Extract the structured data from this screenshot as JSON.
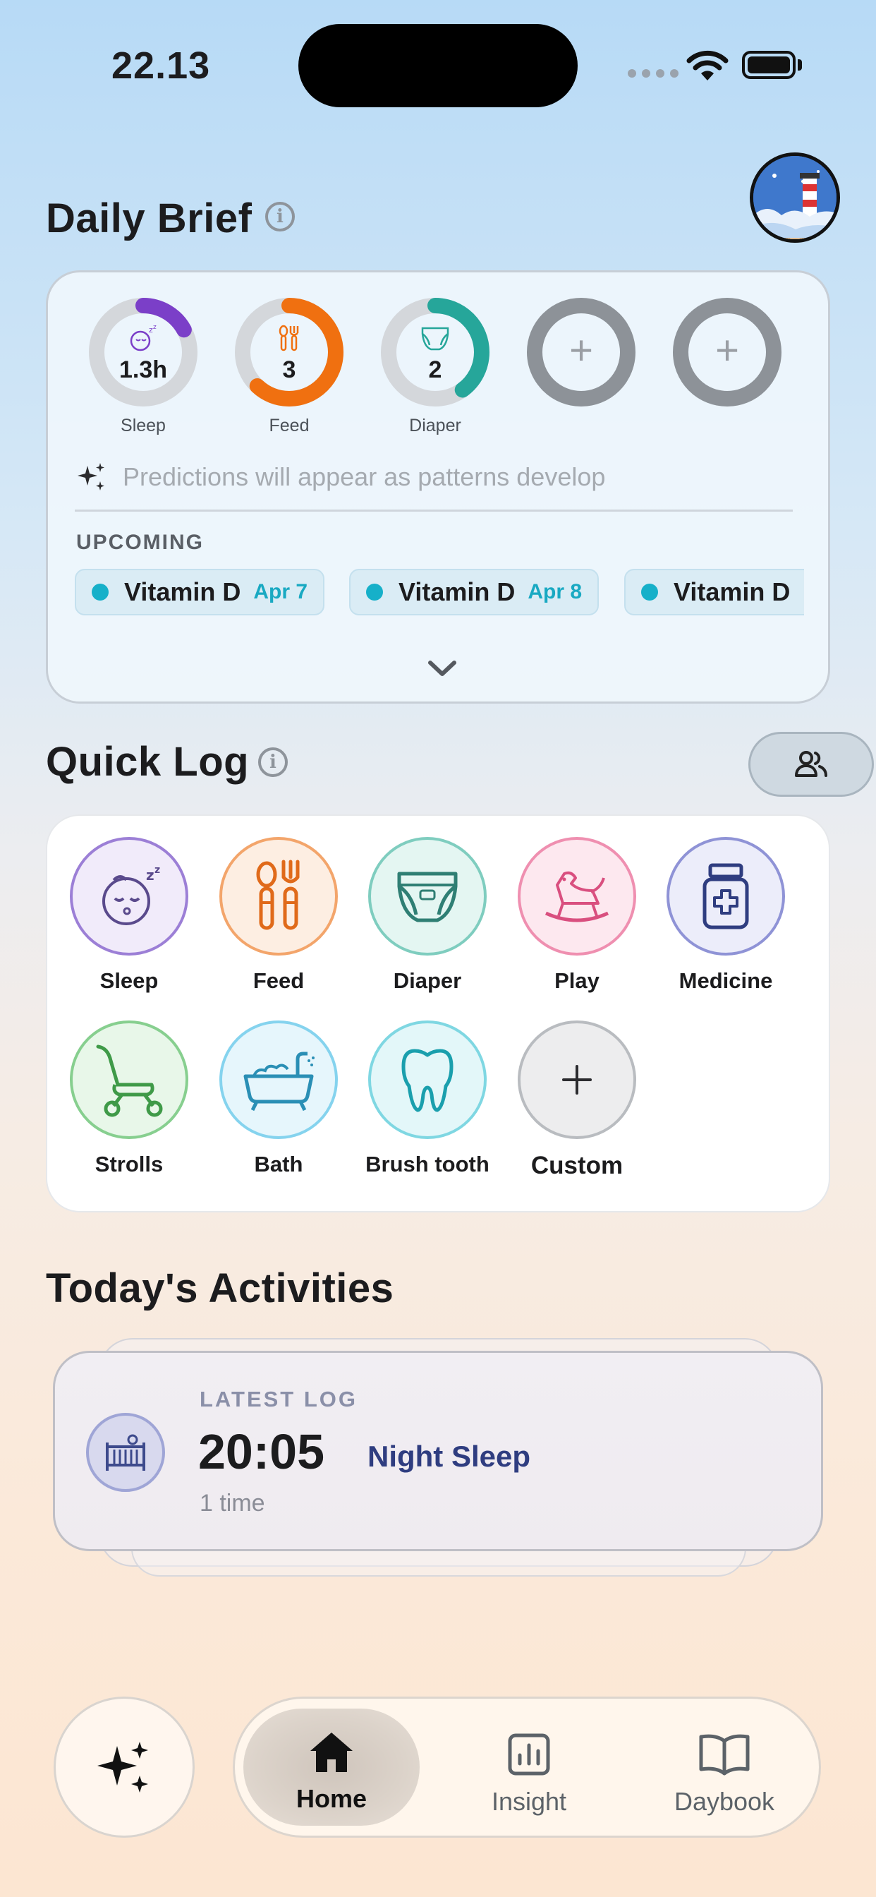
{
  "status_bar": {
    "time": "22.13"
  },
  "daily_brief": {
    "title": "Daily Brief",
    "rings": [
      {
        "label": "Sleep",
        "value": "1.3h",
        "color": "#7b3fc8",
        "progress": 0.17
      },
      {
        "label": "Feed",
        "value": "3",
        "color": "#f07010",
        "progress": 0.62
      },
      {
        "label": "Diaper",
        "value": "2",
        "color": "#26a69a",
        "progress": 0.4
      },
      {
        "label": "",
        "value": "+",
        "color": "#8d9298",
        "progress": 1
      },
      {
        "label": "",
        "value": "+",
        "color": "#8d9298",
        "progress": 1
      }
    ],
    "prediction_text": "Predictions will appear as patterns develop",
    "upcoming_heading": "UPCOMING",
    "upcoming": [
      {
        "name": "Vitamin D",
        "date": "Apr 7"
      },
      {
        "name": "Vitamin D",
        "date": "Apr 8"
      },
      {
        "name": "Vitamin D",
        "date": ""
      }
    ]
  },
  "quick_log": {
    "title": "Quick Log",
    "items": [
      {
        "label": "Sleep",
        "icon": "sleeping-baby-icon",
        "border": "#9c7fd6",
        "bg": "#f1ebfa"
      },
      {
        "label": "Feed",
        "icon": "spoon-fork-icon",
        "border": "#f3a56b",
        "bg": "#fdeee2"
      },
      {
        "label": "Diaper",
        "icon": "diaper-icon",
        "border": "#7fcdbf",
        "bg": "#e4f6f2"
      },
      {
        "label": "Play",
        "icon": "rocking-horse-icon",
        "border": "#ef8fb0",
        "bg": "#fde8ef"
      },
      {
        "label": "Medicine",
        "icon": "medicine-bottle-icon",
        "border": "#8f93d6",
        "bg": "#ecedfa"
      },
      {
        "label": "Strolls",
        "icon": "stroller-icon",
        "border": "#87cf8f",
        "bg": "#e8f7e9"
      },
      {
        "label": "Bath",
        "icon": "bathtub-icon",
        "border": "#85d3ee",
        "bg": "#e6f6fc"
      },
      {
        "label": "Brush tooth",
        "icon": "tooth-icon",
        "border": "#7fd7e2",
        "bg": "#e3f7f9"
      },
      {
        "label": "Custom",
        "icon": "plus-icon",
        "border": "#b9bcc0",
        "bg": "#ededee"
      }
    ]
  },
  "activities": {
    "title": "Today's Activities",
    "latest_label": "LATEST LOG",
    "time": "20:05",
    "name": "Night Sleep",
    "count": "1 time"
  },
  "nav": {
    "tabs": [
      {
        "label": "Home",
        "icon": "home-icon",
        "active": true
      },
      {
        "label": "Insight",
        "icon": "chart-icon",
        "active": false
      },
      {
        "label": "Daybook",
        "icon": "book-icon",
        "active": false
      }
    ]
  }
}
